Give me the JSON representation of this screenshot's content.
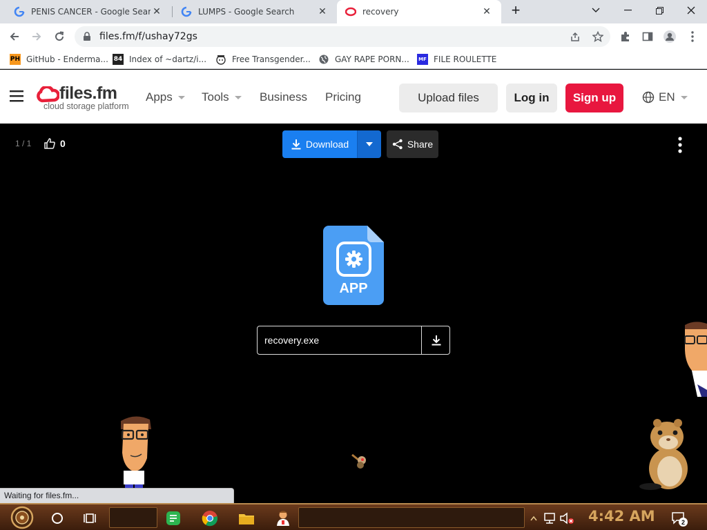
{
  "browser": {
    "tabs": [
      {
        "title": "PENIS CANCER - Google Search",
        "active": false
      },
      {
        "title": "LUMPS - Google Search",
        "active": false
      },
      {
        "title": "recovery",
        "active": true
      }
    ],
    "new_tab_symbol": "+",
    "url": "files.fm/f/ushay72gs",
    "bookmarks": [
      {
        "icon_text": "PH",
        "label": "GitHub - Enderma..."
      },
      {
        "icon_text": "84",
        "label": "Index of ~dartz/i..."
      },
      {
        "icon_text": "",
        "label": "Free Transgender..."
      },
      {
        "icon_text": "",
        "label": "GAY RAPE PORN..."
      },
      {
        "icon_text": "MF",
        "label": "FILE ROULETTE"
      }
    ]
  },
  "site": {
    "logo_name": "files.fm",
    "logo_tagline": "cloud storage platform",
    "nav": {
      "apps": "Apps",
      "tools": "Tools",
      "business": "Business",
      "pricing": "Pricing"
    },
    "upload_label": "Upload files",
    "login_label": "Log in",
    "signup_label": "Sign up",
    "language": "EN"
  },
  "viewer": {
    "page_counter": "1 / 1",
    "likes": "0",
    "download_label": "Download",
    "share_label": "Share",
    "file_icon_label": "APP",
    "file_name": "recovery.exe"
  },
  "status_bar": "Waiting for files.fm...",
  "taskbar": {
    "clock": "4:42 AM",
    "notification_count": "2"
  },
  "colors": {
    "download_blue": "#1a7ff0",
    "signup_red": "#e8173f",
    "logo_red": "#e8203a"
  }
}
